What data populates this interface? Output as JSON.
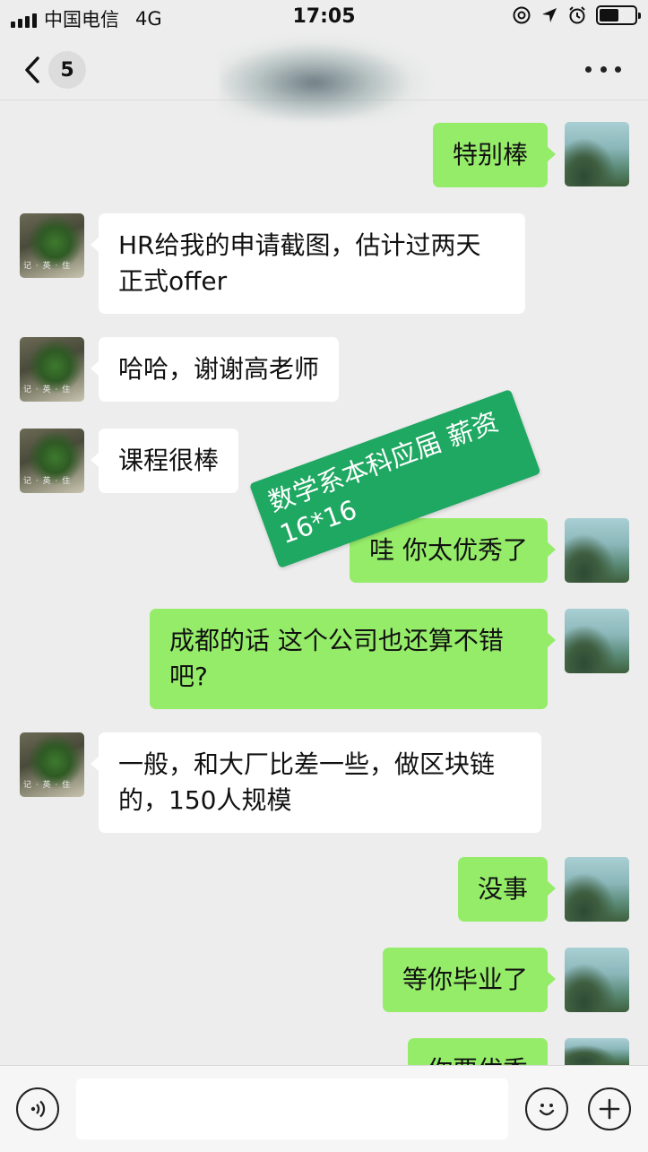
{
  "status_bar": {
    "carrier": "中国电信",
    "network": "4G",
    "time": "17:05"
  },
  "nav": {
    "unread_count": "5"
  },
  "messages": [
    {
      "side": "out",
      "text": "特别棒"
    },
    {
      "side": "in",
      "text": "HR给我的申请截图，估计过两天正式offer"
    },
    {
      "side": "in",
      "text": "哈哈，谢谢高老师"
    },
    {
      "side": "in",
      "text": "课程很棒"
    },
    {
      "side": "out",
      "text": "哇 你太优秀了"
    },
    {
      "side": "out",
      "text": "成都的话 这个公司也还算不错吧?"
    },
    {
      "side": "in",
      "text": "一般，和大厂比差一些，做区块链的，150人规模"
    },
    {
      "side": "out",
      "text": "没事"
    },
    {
      "side": "out",
      "text": "等你毕业了"
    },
    {
      "side": "out",
      "text": "你要优秀"
    }
  ],
  "annotation": {
    "text": "数学系本科应届 薪资16*16"
  },
  "input_bar": {
    "voice_icon": "voice-icon",
    "emoji_icon": "emoji-icon",
    "plus_icon": "plus-icon"
  },
  "colors": {
    "background": "#ededed",
    "outgoing_bubble": "#95ec69",
    "incoming_bubble": "#ffffff",
    "annotation": "#1fa862"
  }
}
